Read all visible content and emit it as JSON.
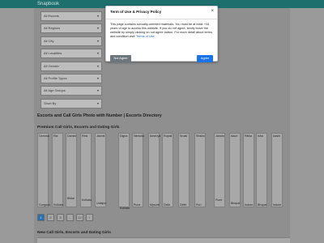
{
  "header": {
    "brand": "Snapbook"
  },
  "filters": {
    "all_escorts": "All Escorts",
    "all_regions": "All Regions",
    "all_city": "All City",
    "all_localities": "All Localities",
    "all_gender": "All Gender",
    "all_profile_types": "All Profile Types",
    "all_age_groups": "All Age Groups",
    "sort_by": "Short By"
  },
  "main": {
    "title": "Escorts and Call Girls Photo with Number | Escorts Directory",
    "premium_heading": "Premium Call Girls, Escorts and Dating Girls",
    "new_heading": "New Call Girls, Escorts and Dating Girls"
  },
  "cards": [
    {
      "name": "Gemma",
      "city": "Gurgaon"
    },
    {
      "name": "Ria",
      "city": "Kolkata"
    },
    {
      "name": "Damini",
      "city": "Bhilai"
    },
    {
      "name": "Resi",
      "city": "Kolkata"
    },
    {
      "name": "Jasmit",
      "city": "Udaipur"
    },
    {
      "name": "Digna",
      "city": "Kolkata"
    },
    {
      "name": "Nimisha",
      "city": "Pune"
    },
    {
      "name": "Amenya",
      "city": "Mysore"
    },
    {
      "name": "Rupali",
      "city": "Delhi"
    },
    {
      "name": "Srusti",
      "city": "Delhi"
    },
    {
      "name": "Shalini",
      "city": "Puri"
    },
    {
      "name": "Janam",
      "city": "Pune"
    },
    {
      "name": "Aauri",
      "city": "Bhopal"
    },
    {
      "name": "Ritika",
      "city": "Indore"
    },
    {
      "name": "Isha",
      "city": "Bhopal"
    },
    {
      "name": "Aashi",
      "city": "Indore"
    }
  ],
  "pagination": {
    "pages": [
      "1",
      "2",
      "3",
      "...",
      "12",
      "›"
    ],
    "active": "1"
  },
  "modal": {
    "title": "Term of Use & Privacy Policy",
    "close": "×",
    "body": "This page contains sexually-oriented materials. You must be at least +18 years of age to access this website. If you do not agree, kindly leave the website by simply clicking on not agree button. For more detail about terms and condition visit:",
    "link": "Terms of Use",
    "disagree": "Not Agree",
    "agree": "Agree"
  }
}
